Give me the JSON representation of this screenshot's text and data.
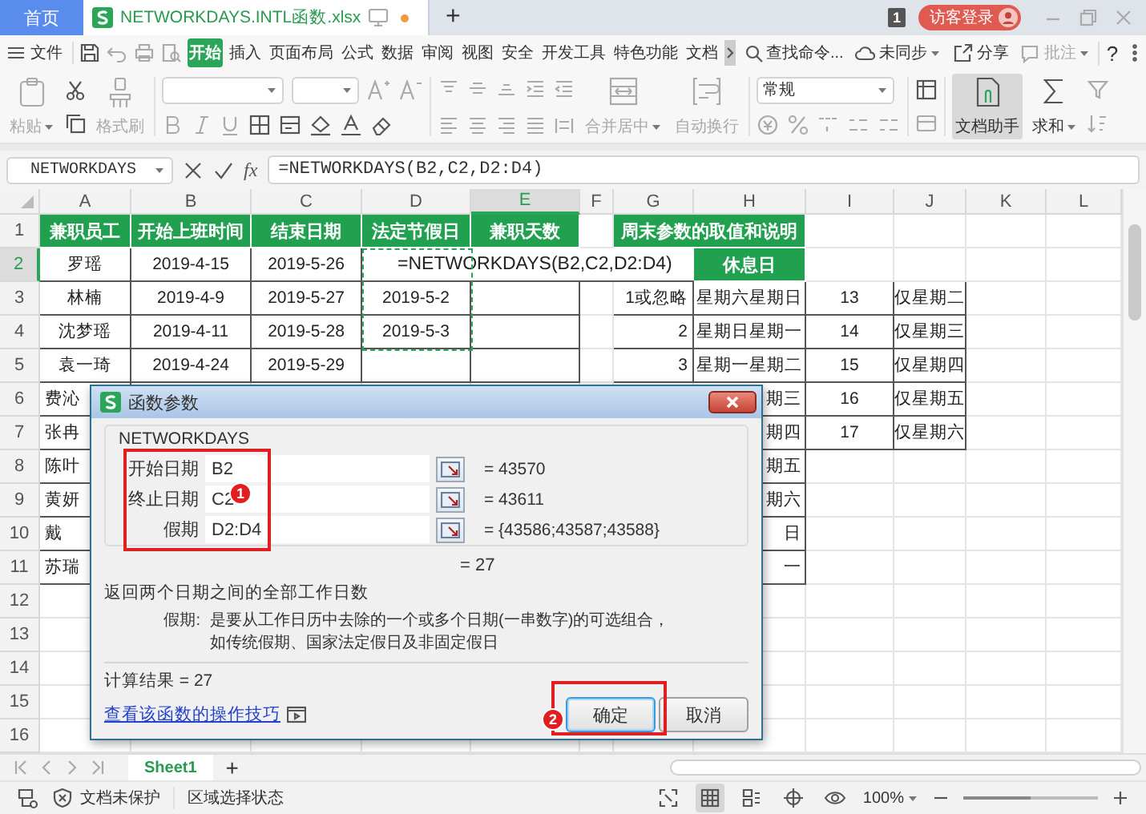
{
  "tab_bar": {
    "tabs": [
      {
        "kind": "home",
        "label": "首页",
        "selected": false
      },
      {
        "kind": "file",
        "label": "NETWORKDAYS.INTL函数.xlsx",
        "selected": true,
        "modified": true
      }
    ],
    "new_tab": "+",
    "window_count": "1",
    "login": "访客登录"
  },
  "menu_bar": {
    "file": "文件",
    "tabs": [
      {
        "label": "开始",
        "selected": true
      },
      {
        "label": "插入",
        "selected": false
      },
      {
        "label": "页面布局",
        "selected": false
      },
      {
        "label": "公式",
        "selected": false
      },
      {
        "label": "数据",
        "selected": false
      },
      {
        "label": "审阅",
        "selected": false
      },
      {
        "label": "视图",
        "selected": false
      },
      {
        "label": "安全",
        "selected": false
      },
      {
        "label": "开发工具",
        "selected": false
      },
      {
        "label": "特色功能",
        "selected": false
      },
      {
        "label": "文档",
        "selected": false
      }
    ],
    "search": "查找命令...",
    "sync": "未同步",
    "share": "分享",
    "comment": {
      "label": "批注",
      "disabled": true
    },
    "help": "?"
  },
  "ribbon": {
    "paste": {
      "label": "粘贴",
      "disabled": true
    },
    "format_painter": {
      "label": "格式刷",
      "disabled": true
    },
    "merge": {
      "label": "合并居中",
      "disabled": true
    },
    "wrap": {
      "label": "自动换行",
      "disabled": true
    },
    "number_format": "常规",
    "assistant": {
      "label": "文档助手",
      "selected": true
    },
    "sum": {
      "label": "求和",
      "disabled": false
    }
  },
  "formula_bar": {
    "name_box": "NETWORKDAYS",
    "function_label": "fx",
    "formula": "=NETWORKDAYS(B2,C2,D2:D4)"
  },
  "sheet": {
    "columns": [
      {
        "label": "A",
        "selected": false
      },
      {
        "label": "B",
        "selected": false
      },
      {
        "label": "C",
        "selected": false
      },
      {
        "label": "D",
        "selected": false
      },
      {
        "label": "E",
        "selected": true
      },
      {
        "label": "F",
        "selected": false
      },
      {
        "label": "G",
        "selected": false
      },
      {
        "label": "H",
        "selected": false
      },
      {
        "label": "I",
        "selected": false
      },
      {
        "label": "J",
        "selected": false
      },
      {
        "label": "K",
        "selected": false
      },
      {
        "label": "L",
        "selected": false
      }
    ],
    "rows": [
      {
        "number": "1",
        "selected": false,
        "cells": [
          {
            "kind": "header",
            "text": "兼职员工"
          },
          {
            "kind": "header",
            "text": "开始上班时间"
          },
          {
            "kind": "header",
            "text": "结束日期"
          },
          {
            "kind": "header",
            "text": "法定节假日"
          },
          {
            "kind": "header",
            "text": "兼职天数"
          },
          {
            "kind": "empty"
          },
          {
            "kind": "header-wide",
            "text": "周末参数的取值和说明"
          }
        ]
      },
      {
        "number": "2",
        "selected": true,
        "cells": [
          {
            "kind": "plain",
            "text": "罗瑶"
          },
          {
            "kind": "plain",
            "text": "2019-4-15"
          },
          {
            "kind": "plain",
            "text": "2019-5-26"
          },
          {
            "kind": "formula",
            "text": "=NETWORKDAYS(B2,C2,D2:D4)"
          },
          {
            "kind": "header",
            "text": "休息日"
          }
        ]
      },
      {
        "number": "3",
        "selected": false,
        "cells": [
          {
            "kind": "plain",
            "text": "林楠"
          },
          {
            "kind": "plain",
            "text": "2019-4-9"
          },
          {
            "kind": "plain",
            "text": "2019-5-27"
          },
          {
            "kind": "plain",
            "text": "2019-5-2"
          },
          {
            "kind": "plain"
          },
          {
            "kind": "empty"
          },
          {
            "kind": "number",
            "text": "1或忽略"
          },
          {
            "kind": "plain",
            "text": "星期六星期日"
          },
          {
            "kind": "plain",
            "text": "13"
          },
          {
            "kind": "plain",
            "text": "仅星期二"
          }
        ]
      },
      {
        "number": "4",
        "selected": false,
        "cells": [
          {
            "kind": "plain",
            "text": "沈梦瑶"
          },
          {
            "kind": "plain",
            "text": "2019-4-11"
          },
          {
            "kind": "plain",
            "text": "2019-5-28"
          },
          {
            "kind": "plain",
            "text": "2019-5-3"
          },
          {
            "kind": "plain"
          },
          {
            "kind": "empty"
          },
          {
            "kind": "number",
            "text": "2"
          },
          {
            "kind": "plain",
            "text": "星期日星期一"
          },
          {
            "kind": "plain",
            "text": "14"
          },
          {
            "kind": "plain",
            "text": "仅星期三"
          }
        ]
      },
      {
        "number": "5",
        "selected": false,
        "cells": [
          {
            "kind": "plain",
            "text": "袁一琦"
          },
          {
            "kind": "plain",
            "text": "2019-4-24"
          },
          {
            "kind": "plain",
            "text": "2019-5-29"
          },
          {
            "kind": "plain"
          },
          {
            "kind": "plain"
          },
          {
            "kind": "empty"
          },
          {
            "kind": "number",
            "text": "3"
          },
          {
            "kind": "plain",
            "text": "星期一星期二"
          },
          {
            "kind": "plain",
            "text": "15"
          },
          {
            "kind": "plain",
            "text": "仅星期四"
          }
        ]
      },
      {
        "number": "6",
        "selected": false,
        "cells": [
          {
            "kind": "partial-left",
            "text": "费沁"
          },
          {
            "kind": "covered"
          },
          {
            "kind": "covered"
          },
          {
            "kind": "covered"
          },
          {
            "kind": "covered"
          },
          {
            "kind": "covered"
          },
          {
            "kind": "covered"
          },
          {
            "kind": "partial-right",
            "text": "期三"
          },
          {
            "kind": "plain",
            "text": "16"
          },
          {
            "kind": "plain",
            "text": "仅星期五"
          }
        ]
      },
      {
        "number": "7",
        "selected": false,
        "cells": [
          {
            "kind": "partial-left",
            "text": "张冉"
          },
          {
            "kind": "covered"
          },
          {
            "kind": "covered"
          },
          {
            "kind": "covered"
          },
          {
            "kind": "covered"
          },
          {
            "kind": "covered"
          },
          {
            "kind": "covered"
          },
          {
            "kind": "partial-right",
            "text": "期四"
          },
          {
            "kind": "plain",
            "text": "17"
          },
          {
            "kind": "plain",
            "text": "仅星期六"
          }
        ]
      },
      {
        "number": "8",
        "selected": false,
        "cells": [
          {
            "kind": "partial-left",
            "text": "陈叶"
          },
          {
            "kind": "covered"
          },
          {
            "kind": "covered"
          },
          {
            "kind": "covered"
          },
          {
            "kind": "covered"
          },
          {
            "kind": "covered"
          },
          {
            "kind": "covered"
          },
          {
            "kind": "partial-right",
            "text": "期五"
          }
        ]
      },
      {
        "number": "9",
        "selected": false,
        "cells": [
          {
            "kind": "partial-left",
            "text": "黄妍"
          },
          {
            "kind": "covered"
          },
          {
            "kind": "covered"
          },
          {
            "kind": "covered"
          },
          {
            "kind": "covered"
          },
          {
            "kind": "covered"
          },
          {
            "kind": "covered"
          },
          {
            "kind": "partial-right",
            "text": "期六"
          }
        ]
      },
      {
        "number": "10",
        "selected": false,
        "cells": [
          {
            "kind": "partial-left",
            "text": "戴"
          },
          {
            "kind": "covered"
          },
          {
            "kind": "covered"
          },
          {
            "kind": "covered"
          },
          {
            "kind": "covered"
          },
          {
            "kind": "covered"
          },
          {
            "kind": "covered"
          },
          {
            "kind": "partial-right",
            "text": "日"
          }
        ]
      },
      {
        "number": "11",
        "selected": false,
        "cells": [
          {
            "kind": "partial-left",
            "text": "苏瑞"
          },
          {
            "kind": "covered"
          },
          {
            "kind": "covered"
          },
          {
            "kind": "covered"
          },
          {
            "kind": "covered"
          },
          {
            "kind": "covered"
          },
          {
            "kind": "covered"
          },
          {
            "kind": "partial-right",
            "text": "一"
          }
        ]
      },
      {
        "number": "12",
        "selected": false,
        "cells": [
          {
            "kind": "empty"
          },
          {
            "kind": "covered"
          },
          {
            "kind": "covered"
          },
          {
            "kind": "covered"
          },
          {
            "kind": "covered"
          },
          {
            "kind": "covered"
          },
          {
            "kind": "covered"
          }
        ]
      },
      {
        "number": "13",
        "selected": false,
        "cells": [
          {
            "kind": "empty"
          },
          {
            "kind": "covered"
          },
          {
            "kind": "covered"
          },
          {
            "kind": "covered"
          },
          {
            "kind": "covered"
          },
          {
            "kind": "covered"
          },
          {
            "kind": "covered"
          }
        ]
      },
      {
        "number": "14",
        "selected": false,
        "cells": [
          {
            "kind": "empty"
          },
          {
            "kind": "covered"
          },
          {
            "kind": "covered"
          },
          {
            "kind": "covered"
          },
          {
            "kind": "covered"
          },
          {
            "kind": "covered"
          },
          {
            "kind": "covered"
          }
        ]
      },
      {
        "number": "15",
        "selected": false,
        "cells": [
          {
            "kind": "empty"
          },
          {
            "kind": "covered"
          },
          {
            "kind": "covered"
          },
          {
            "kind": "covered"
          },
          {
            "kind": "covered"
          },
          {
            "kind": "covered"
          },
          {
            "kind": "covered"
          }
        ]
      },
      {
        "number": "16",
        "selected": false
      }
    ]
  },
  "dialog": {
    "title": "函数参数",
    "function_name": "NETWORKDAYS",
    "params": [
      {
        "label": "开始日期",
        "value": "B2",
        "result": "= 43570"
      },
      {
        "label": "终止日期",
        "value": "C2",
        "result": "= 43611"
      },
      {
        "label": "假期",
        "value": "D2:D4",
        "result": "= {43586;43587;43588}"
      }
    ],
    "formula_result": "= 27",
    "description": "返回两个日期之间的全部工作日数",
    "param_name": "假期:",
    "param_help": "是要从工作日历中去除的一个或多个日期(一串数字)的可选组合，如传统假期、国家法定假日及非固定假日",
    "calc_result": "计算结果 = 27",
    "help_link": "查看该函数的操作技巧",
    "buttons": [
      {
        "label": "确定",
        "kind": "default"
      },
      {
        "label": "取消",
        "kind": "normal"
      }
    ],
    "annotations": [
      {
        "kind": "params",
        "label": "1"
      },
      {
        "kind": "ok",
        "label": "2"
      }
    ]
  },
  "sheet_tabs": {
    "tabs": [
      {
        "label": "Sheet1",
        "selected": true
      }
    ],
    "add": "+"
  },
  "status_bar": {
    "protection": "文档未保护",
    "mode": "区域选择状态",
    "views": [
      {
        "kind": "fullscreen",
        "selected": false
      },
      {
        "kind": "normal",
        "selected": true
      },
      {
        "kind": "page-break",
        "selected": false
      },
      {
        "kind": "page-layout",
        "selected": false
      },
      {
        "kind": "reading",
        "selected": false
      }
    ],
    "zoom": "100%",
    "zoom_slider": {
      "level": 0.5
    }
  }
}
